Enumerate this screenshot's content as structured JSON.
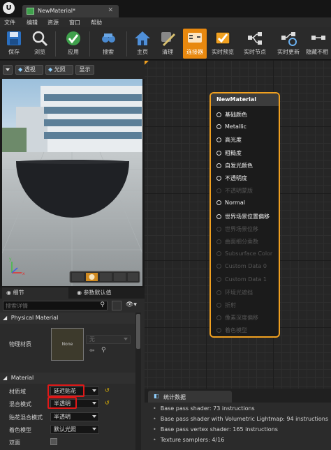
{
  "window": {
    "tab_title": "NewMaterial*",
    "close_glyph": "✕"
  },
  "menu": [
    "文件",
    "编辑",
    "资源",
    "窗口",
    "帮助"
  ],
  "toolbar": [
    {
      "label": "保存",
      "icon": "save-icon"
    },
    {
      "label": "浏览",
      "icon": "browse-icon"
    },
    {
      "label": "应用",
      "icon": "apply-icon"
    },
    {
      "label": "搜索",
      "icon": "search-icon"
    },
    {
      "label": "主页",
      "icon": "home-icon"
    },
    {
      "label": "清理",
      "icon": "clean-icon"
    },
    {
      "label": "连接器",
      "icon": "connector-icon",
      "active": true
    },
    {
      "label": "实时预览",
      "icon": "live-preview-icon"
    },
    {
      "label": "实时节点",
      "icon": "live-nodes-icon"
    },
    {
      "label": "实时更新",
      "icon": "live-update-icon"
    },
    {
      "label": "隐藏不相",
      "icon": "hide-unrelated-icon"
    }
  ],
  "viewport_toolbar": {
    "perspective": "透视",
    "lit": "光照",
    "show": "显示"
  },
  "details": {
    "tab_details": "细节",
    "tab_param_defaults": "参数默认值",
    "search_placeholder": "搜索详情",
    "physical_material_header": "Physical Material",
    "phys_mat_label": "物理材质",
    "thumbnail_text": "None",
    "phys_mat_value": "无",
    "material_header": "Material",
    "props": [
      {
        "label": "材质域",
        "value": "延迟贴花"
      },
      {
        "label": "混合模式",
        "value": "半透明"
      },
      {
        "label": "贴花混合模式",
        "value": "半透明"
      },
      {
        "label": "着色模型",
        "value": "默认光照"
      },
      {
        "label": "双面",
        "value": ""
      }
    ],
    "reset_glyph": "↺"
  },
  "node": {
    "title": "NewMaterial",
    "pins": [
      {
        "label": "基础颜色",
        "enabled": true
      },
      {
        "label": "Metallic",
        "enabled": true
      },
      {
        "label": "高光度",
        "enabled": true
      },
      {
        "label": "粗糙度",
        "enabled": true
      },
      {
        "label": "自发光颜色",
        "enabled": true
      },
      {
        "label": "不透明度",
        "enabled": true
      },
      {
        "label": "不透明蒙版",
        "enabled": false
      },
      {
        "label": "Normal",
        "enabled": true
      },
      {
        "label": "世界场景位置偏移",
        "enabled": true
      },
      {
        "label": "世界场景位移",
        "enabled": false
      },
      {
        "label": "曲面细分乘数",
        "enabled": false
      },
      {
        "label": "Subsurface Color",
        "enabled": false
      },
      {
        "label": "Custom Data 0",
        "enabled": false
      },
      {
        "label": "Custom Data 1",
        "enabled": false
      },
      {
        "label": "环境光遮挡",
        "enabled": false
      },
      {
        "label": "折射",
        "enabled": false
      },
      {
        "label": "像素深度偏移",
        "enabled": false
      },
      {
        "label": "着色模型",
        "enabled": false
      }
    ]
  },
  "stats": {
    "tab_label": "统计数据",
    "lines": [
      "Base pass shader: 73 instructions",
      "Base pass shader with Volumetric Lightmap: 94 instructions",
      "Base pass vertex shader: 165 instructions",
      "Texture samplers: 4/16"
    ]
  },
  "colors": {
    "accent": "#e8880e",
    "node_border": "#f0a020",
    "highlight": "#e01818"
  }
}
